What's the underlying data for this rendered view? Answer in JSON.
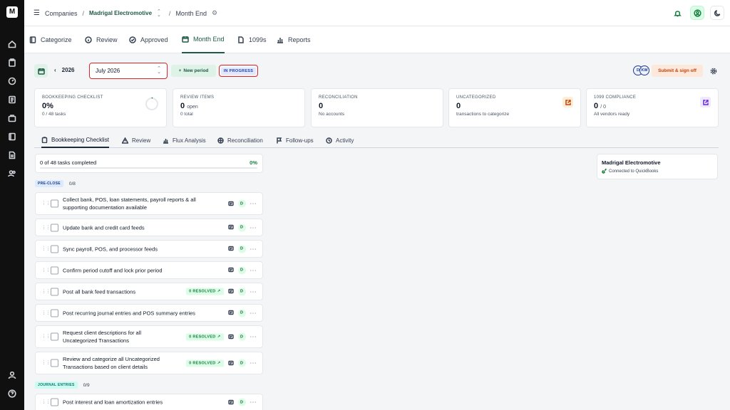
{
  "app": {
    "logo_letter": "M"
  },
  "breadcrumb": {
    "root": "Companies",
    "company": "Madrigal Electromotive",
    "page": "Month End"
  },
  "tabs": [
    {
      "label": "Categorize",
      "icon": "book-icon"
    },
    {
      "label": "Review",
      "icon": "info-icon"
    },
    {
      "label": "Approved",
      "icon": "check-circle-icon"
    },
    {
      "label": "Month End",
      "icon": "calendar-icon"
    },
    {
      "label": "1099s",
      "icon": "document-icon"
    },
    {
      "label": "Reports",
      "icon": "bar-chart-icon"
    }
  ],
  "period": {
    "year": "2026",
    "month_value": "July 2026",
    "new_period_label": "New period",
    "status": "IN PROGRESS",
    "avatar_initials_1": "D",
    "avatar_initials_2": "KW",
    "signoff_label": "Submit & sign off"
  },
  "cards": {
    "bookkeeping": {
      "title": "BOOKKEEPING CHECKLIST",
      "value": "0%",
      "sub": "0 / 48 tasks"
    },
    "review": {
      "title": "REVIEW ITEMS",
      "value": "0",
      "unit": "open",
      "sub": "0 total"
    },
    "reconciliation": {
      "title": "RECONCILIATION",
      "value": "0",
      "sub": "No accounts"
    },
    "uncategorized": {
      "title": "UNCATEGORIZED",
      "value": "0",
      "sub": "transactions to categorize"
    },
    "compliance": {
      "title": "1099 COMPLIANCE",
      "value": "0",
      "unit": "/ 0",
      "sub": "All vendors ready"
    }
  },
  "subtabs": [
    {
      "label": "Bookkeeping Checklist"
    },
    {
      "label": "Review"
    },
    {
      "label": "Flux Analysis"
    },
    {
      "label": "Reconciliation"
    },
    {
      "label": "Follow-ups"
    },
    {
      "label": "Activity"
    }
  ],
  "checklist": {
    "summary": "0 of 48 tasks completed",
    "percent": "0%",
    "progress_fraction": 0,
    "sections": [
      {
        "badge": "PRE-CLOSE",
        "count": "0/8"
      },
      {
        "badge": "JOURNAL ENTRIES",
        "count": "0/9"
      }
    ],
    "tasks": [
      {
        "line1": "Collect bank, POS, loan statements, payroll reports & all",
        "line2": "supporting documentation available",
        "assignee": "D"
      },
      {
        "line1": "Update bank and credit card feeds",
        "assignee": "D"
      },
      {
        "line1": "Sync payroll, POS, and processor feeds",
        "assignee": "D"
      },
      {
        "line1": "Confirm period cutoff and lock prior period",
        "assignee": "D"
      },
      {
        "line1": "Post all bank feed transactions",
        "resolved": "0 RESOLVED",
        "assignee": "D"
      },
      {
        "line1": "Post recurring journal entries and POS summary entries",
        "assignee": "D"
      },
      {
        "line1": "Request client descriptions for all",
        "line2": "Uncategorized Transactions",
        "resolved": "0 RESOLVED",
        "assignee": "D"
      },
      {
        "line1": "Review and categorize all Uncategorized",
        "line2": "Transactions based on client details",
        "resolved": "0 RESOLVED",
        "assignee": "D"
      },
      {
        "line1": "Post interest and loan amortization entries",
        "assignee": "D"
      }
    ]
  },
  "company_card": {
    "name": "Madrigal Electromotive",
    "status": "Connected to QuickBooks"
  }
}
